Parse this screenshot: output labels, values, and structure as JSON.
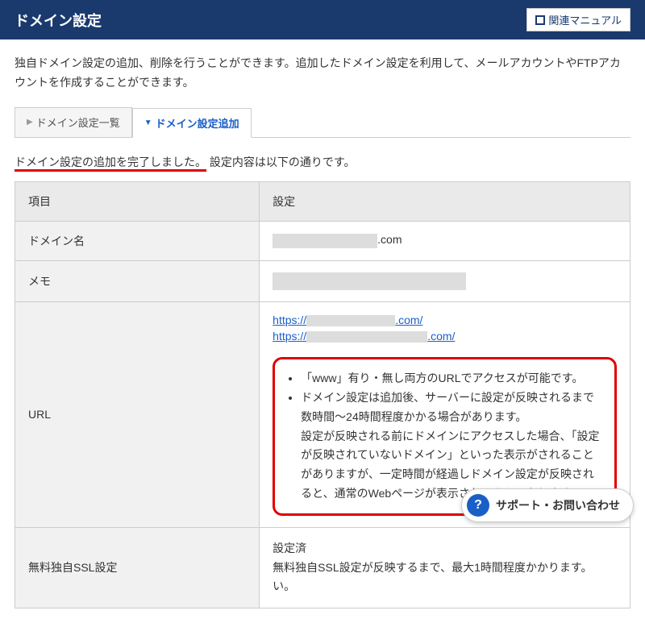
{
  "header": {
    "title": "ドメイン設定",
    "manual_label": "関連マニュアル"
  },
  "description": "独自ドメイン設定の追加、削除を行うことができます。追加したドメイン設定を利用して、メールアカウントやFTPアカウントを作成することができます。",
  "tabs": {
    "list": "ドメイン設定一覧",
    "add": "ドメイン設定追加"
  },
  "status": {
    "highlight": "ドメイン設定の追加を完了しました。",
    "rest": "設定内容は以下の通りです。"
  },
  "thead": {
    "col1": "項目",
    "col2": "設定"
  },
  "rows": {
    "domain": {
      "label": "ドメイン名",
      "suffix": ".com"
    },
    "memo": {
      "label": "メモ"
    },
    "url": {
      "label": "URL",
      "link1_prefix": "https://",
      "link1_suffix": ".com/",
      "link2_prefix": "https://",
      "link2_suffix": ".com/",
      "notice_bullet1": "「www」有り・無し両方のURLでアクセスが可能です。",
      "notice_bullet2": "ドメイン設定は追加後、サーバーに設定が反映されるまで数時間～24時間程度かかる場合があります。",
      "notice_cont": "設定が反映される前にドメインにアクセスした場合、「設定が反映されていないドメイン」といった表示がされることがありますが、一定時間が経過しドメイン設定が反映されると、通常のWebページが表示されるようになります。"
    },
    "ssl": {
      "label": "無料独自SSL設定",
      "status": "設定済",
      "note_a": "無料独自SSL設定が反映するまで、最大1時間程度かかります。",
      "note_b": "い。"
    }
  },
  "support": {
    "label": "サポート・お問い合わせ"
  }
}
